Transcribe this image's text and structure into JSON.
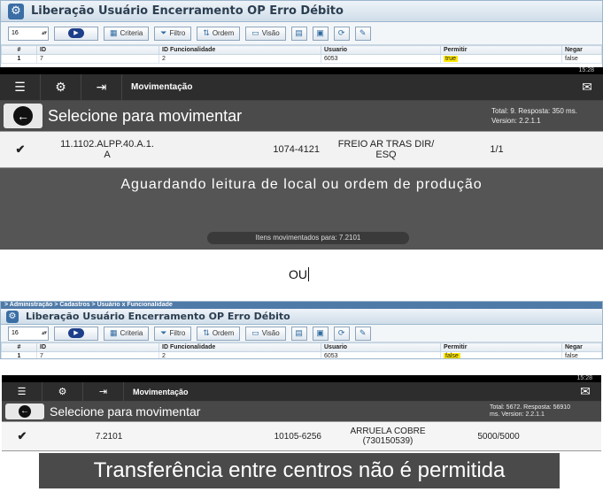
{
  "web1": {
    "title": "Liberação Usuário Encerramento OP Erro Débito",
    "toolbar": {
      "page_size": "16",
      "criteria": "Criteria",
      "filtro": "Filtro",
      "ordem": "Ordem",
      "visao": "Visão"
    },
    "columns": [
      "#",
      "ID",
      "ID Funcionalidade",
      "Usuario",
      "Permitir",
      "Negar"
    ],
    "rows": [
      [
        "1",
        "7",
        "2",
        "6053",
        "true",
        "false"
      ]
    ]
  },
  "app1": {
    "status_time": "15:28",
    "title": "Movimentação",
    "select_label": "Selecione para movimentar",
    "meta_total": "Total: 9. Resposta: 350 ms.",
    "meta_version": "Version: 2.2.1.1",
    "row": {
      "item": "11.1102.ALPP.40.A.1.\nA",
      "code": "1074-4121",
      "desc": "FREIO AR TRAS DIR/\nESQ",
      "qty": "1/1"
    },
    "waiting": "Aguardando leitura de local ou ordem de produção",
    "moved": "Itens movimentados para: 7.2101"
  },
  "separator": "OU",
  "web2": {
    "breadcrumb": "> Administração > Cadastros > Usuário x Funcionalidade",
    "title": "Liberação Usuário Encerramento OP Erro Débito",
    "toolbar": {
      "page_size": "16",
      "criteria": "Criteria",
      "filtro": "Filtro",
      "ordem": "Ordem",
      "visao": "Visão"
    },
    "columns": [
      "#",
      "ID",
      "ID Funcionalidade",
      "Usuario",
      "Permitir",
      "Negar"
    ],
    "rows": [
      [
        "1",
        "7",
        "2",
        "6053",
        "false",
        "false"
      ]
    ]
  },
  "app2": {
    "status_time": "15:28",
    "title": "Movimentação",
    "select_label": "Selecione para movimentar",
    "meta_total": "Total: 5672. Resposta: 56910",
    "meta_version": "ms. Version: 2.2.1.1",
    "row": {
      "item": "7.2101",
      "code": "10105-6256",
      "desc": "ARRUELA COBRE\n(730150539)",
      "qty": "5000/5000"
    }
  },
  "toast": "Transferência entre centros não é permitida"
}
